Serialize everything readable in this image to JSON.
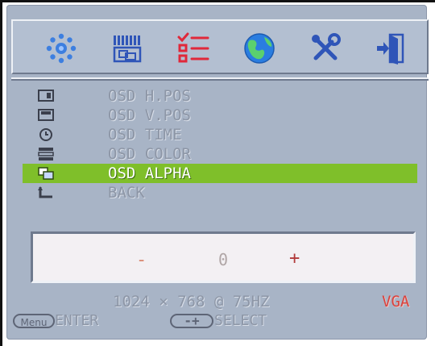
{
  "tabs": [
    {
      "icon": "picture-icon"
    },
    {
      "icon": "image-settings-icon"
    },
    {
      "icon": "osd-setup-icon",
      "active": true
    },
    {
      "icon": "language-globe-icon"
    },
    {
      "icon": "tools-icon"
    },
    {
      "icon": "exit-icon"
    }
  ],
  "menu": {
    "items": [
      {
        "label": "OSD H.POS",
        "icon": "h-position-icon"
      },
      {
        "label": "OSD V.POS",
        "icon": "v-position-icon"
      },
      {
        "label": "OSD TIME",
        "icon": "clock-icon"
      },
      {
        "label": "OSD COLOR",
        "icon": "color-icon"
      },
      {
        "label": "OSD ALPHA",
        "icon": "alpha-icon",
        "selected": true
      },
      {
        "label": "BACK",
        "icon": "back-arrow-icon"
      }
    ]
  },
  "adjust": {
    "minus": "-",
    "value": "0",
    "plus": "+"
  },
  "status": {
    "resolution": "1024 × 768 @ 75HZ",
    "source": "VGA"
  },
  "hints": {
    "menu_key": "Menu",
    "enter": "ENTER",
    "adjust_key": "-+",
    "select": "SELECT"
  },
  "colors": {
    "background": "#a8b4c6",
    "selected": "#7fbf2a",
    "source": "#d9433e"
  }
}
